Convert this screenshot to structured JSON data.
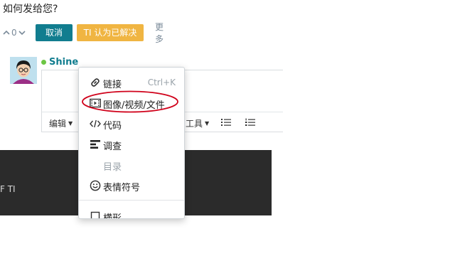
{
  "question": {
    "title": "如何发给您?"
  },
  "actions": {
    "vote_count": "0",
    "cancel_label": "取消",
    "resolve_label": "TI 认为已解决",
    "more_label": "更多"
  },
  "user": {
    "name": "Shine"
  },
  "toolbar": {
    "edit_label": "编辑",
    "tools_label": "工具"
  },
  "dark_panel": {
    "edge_text": "F TI"
  },
  "insert_menu": {
    "items": [
      {
        "label": "链接",
        "shortcut": "Ctrl+K",
        "icon": "link-icon"
      },
      {
        "label": "图像/视频/文件",
        "icon": "media-icon"
      },
      {
        "label": "代码",
        "icon": "code-icon"
      },
      {
        "label": "调查",
        "icon": "poll-icon"
      },
      {
        "label": "目录",
        "icon": ""
      },
      {
        "label": "表情符号",
        "icon": "smiley-icon"
      },
      {
        "label": "横形",
        "icon": "checkbox-icon"
      }
    ]
  },
  "colors": {
    "primary": "#117d8f",
    "warning": "#f0b542",
    "online": "#6cc644",
    "highlight": "#d0021b"
  }
}
